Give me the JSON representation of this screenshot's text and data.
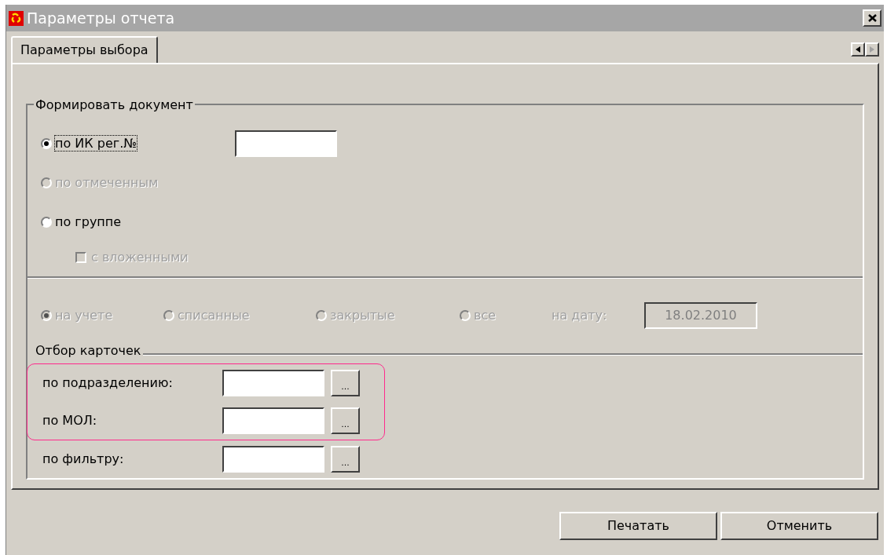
{
  "window": {
    "title": "Параметры отчета"
  },
  "tabs": [
    {
      "label": "Параметры выбора",
      "selected": true
    }
  ],
  "document_group": {
    "title": "Формировать документ",
    "items": [
      {
        "kind": "radio_field",
        "label": "по ИК рег.№",
        "selected": true,
        "disabled": false,
        "focused": true
      },
      {
        "kind": "radio",
        "label": "по отмеченным",
        "selected": false,
        "disabled": true,
        "focused": false
      },
      {
        "kind": "radio",
        "label": "по группе",
        "selected": false,
        "disabled": false,
        "focused": false
      },
      {
        "kind": "checkbox",
        "label": "с вложенными",
        "checked": false,
        "disabled": true
      }
    ]
  },
  "status_row": {
    "options": [
      {
        "label": "на учете",
        "selected": true,
        "disabled": true
      },
      {
        "label": "списанные",
        "selected": false,
        "disabled": true
      },
      {
        "label": "закрытые",
        "selected": false,
        "disabled": true
      },
      {
        "label": "все",
        "selected": false,
        "disabled": true
      }
    ],
    "date_label": "на дату:",
    "date_value": "18.02.2010",
    "date_disabled": true
  },
  "filter_group": {
    "title": "Отбор карточек",
    "rows": [
      {
        "label": "по подразделению:",
        "button": "...",
        "highlighted": true
      },
      {
        "label": "по МОЛ:",
        "button": "...",
        "highlighted": true
      },
      {
        "label": "по фильтру:",
        "button": "...",
        "highlighted": false
      }
    ]
  },
  "buttons": [
    "Печатать",
    "Отменить"
  ]
}
